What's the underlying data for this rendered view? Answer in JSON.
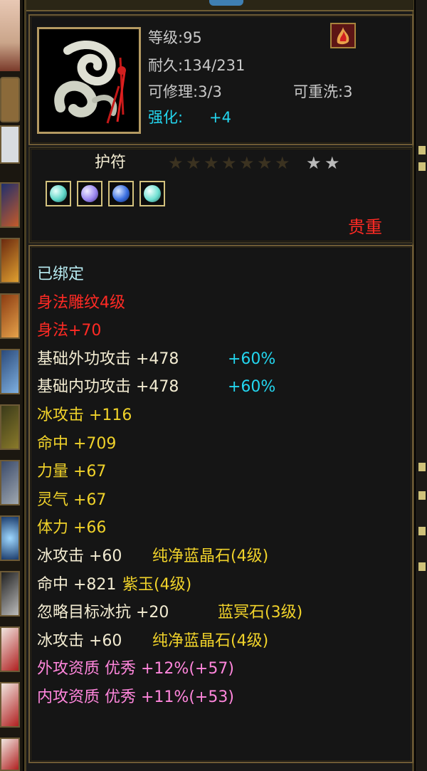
{
  "item": {
    "level_label": "等级:95",
    "durability_label": "耐久:134/231",
    "repair_label": "可修理:3/3",
    "rewash_label": "可重洗:3",
    "enhance_label": "强化:",
    "enhance_value": "+4",
    "type_label": "护符",
    "rarity_label": "贵重",
    "stars_total": 9,
    "stars_lit": 7
  },
  "gem_slots": [
    {
      "icon": "teal-gem-icon",
      "color": "#5fd6c8"
    },
    {
      "icon": "violet-gem-icon",
      "color": "#9b88f0"
    },
    {
      "icon": "blue-gem-icon",
      "color": "#3a6fe0"
    },
    {
      "icon": "teal-gem-icon",
      "color": "#6fe0d2"
    }
  ],
  "attributes": [
    {
      "text": "已绑定",
      "color": "#b8ecf2"
    },
    {
      "text": "身法雕纹4级",
      "color": "#ff2a24"
    },
    {
      "text": "身法+70",
      "color": "#ff2a24"
    },
    {
      "text": "基础外功攻击 +478",
      "extra": "+60%",
      "color": "#f3ecd2",
      "extra_color": "#23d6ef"
    },
    {
      "text": "基础内功攻击 +478",
      "extra": "+60%",
      "color": "#f3ecd2",
      "extra_color": "#23d6ef"
    },
    {
      "text": "冰攻击 +116",
      "color": "#f0d22a"
    },
    {
      "text": "命中 +709",
      "color": "#f0d22a"
    },
    {
      "text": "力量 +67",
      "color": "#f0d22a"
    },
    {
      "text": "灵气 +67",
      "color": "#f0d22a"
    },
    {
      "text": "体力 +66",
      "color": "#f0d22a"
    },
    {
      "text": "冰攻击 +60",
      "extra": "纯净蓝晶石(4级)",
      "color": "#f3ecd2",
      "extra_color": "#f0d22a"
    },
    {
      "text": "命中 +821",
      "extra": "紫玉(4级)",
      "color": "#f3ecd2",
      "extra_color": "#f0d22a"
    },
    {
      "text": "忽略目标冰抗 +20",
      "extra": "蓝冥石(3级)",
      "color": "#f3ecd2",
      "extra_color": "#f0d22a"
    },
    {
      "text": "冰攻击 +60",
      "extra": "纯净蓝晶石(4级)",
      "color": "#f3ecd2",
      "extra_color": "#f0d22a"
    },
    {
      "text": "外攻资质  优秀 +12%(+57)",
      "color": "#ff86dc"
    },
    {
      "text": "内攻资质  优秀 +11%(+53)",
      "color": "#ff86dc"
    }
  ],
  "colors": {
    "frame": "#6e5b35",
    "panel_bg": "#1a1a1a",
    "star_lit": "#3b3220",
    "star_unlit": "#b9b9b9"
  }
}
